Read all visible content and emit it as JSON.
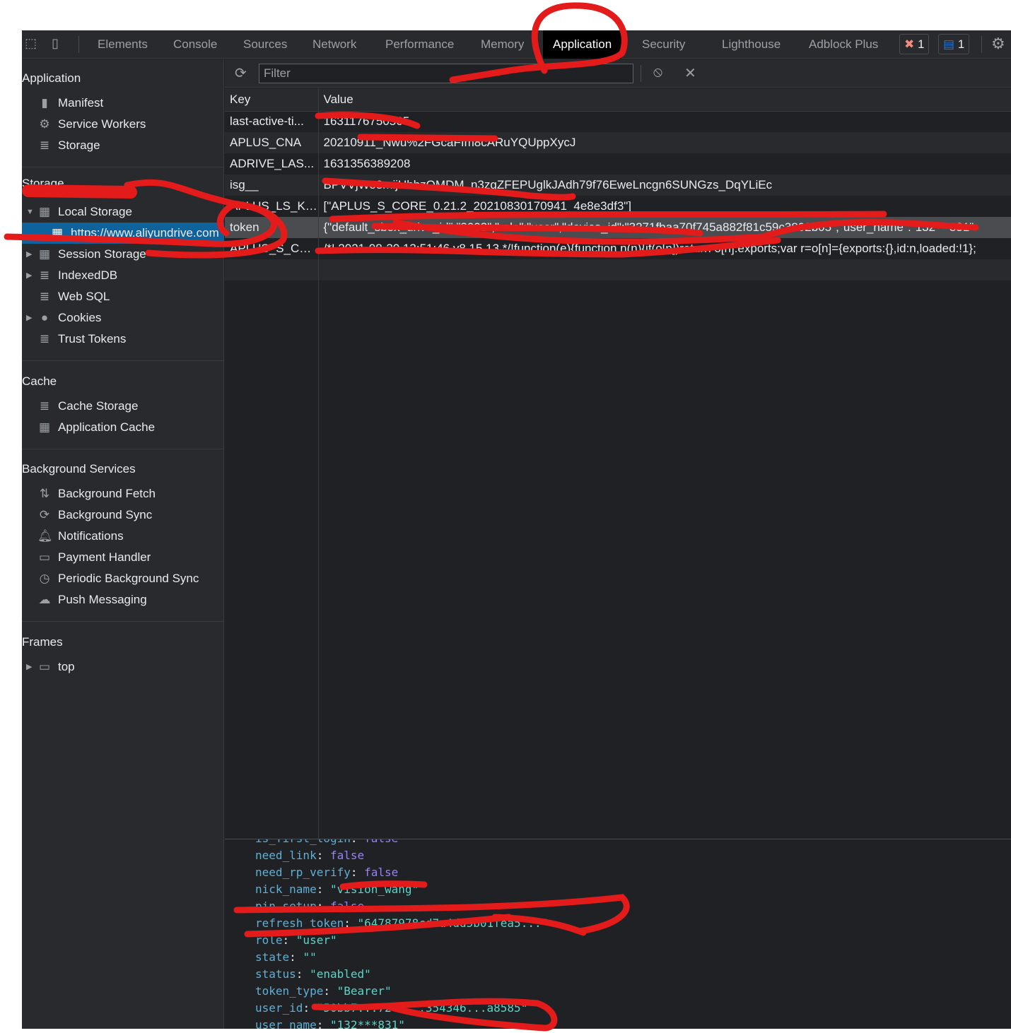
{
  "toolbar": {
    "tabs": [
      "Elements",
      "Console",
      "Sources",
      "Network",
      "Performance",
      "Memory",
      "Application",
      "Security",
      "Lighthouse",
      "Adblock Plus"
    ],
    "active_tab": "Application",
    "errors": "1",
    "messages": "1"
  },
  "sidebar": {
    "application": {
      "title": "Application",
      "items": [
        "Manifest",
        "Service Workers",
        "Storage"
      ]
    },
    "storage": {
      "title": "Storage",
      "items": [
        "Local Storage",
        "https://www.aliyundrive.com",
        "Session Storage",
        "IndexedDB",
        "Web SQL",
        "Cookies",
        "Trust Tokens"
      ]
    },
    "cache": {
      "title": "Cache",
      "items": [
        "Cache Storage",
        "Application Cache"
      ]
    },
    "background": {
      "title": "Background Services",
      "items": [
        "Background Fetch",
        "Background Sync",
        "Notifications",
        "Payment Handler",
        "Periodic Background Sync",
        "Push Messaging"
      ]
    },
    "frames": {
      "title": "Frames",
      "items": [
        "top"
      ]
    }
  },
  "filter": {
    "placeholder": "Filter"
  },
  "table": {
    "headers": [
      "Key",
      "Value"
    ],
    "rows": [
      {
        "key": "last-active-ti...",
        "value": "1631176750565"
      },
      {
        "key": "APLUS_CNA",
        "value": "20210911_Nwu%2FGcaFIm8cARuYQUppXycJ"
      },
      {
        "key": "ADRIVE_LAS...",
        "value": "1631356389208"
      },
      {
        "key": "isg__",
        "value": "BPVVjWo8mijUhbzOMDM_n3zgZFEPUglkJAdh79f76EweLncgn6SUNGzs_DqYLiEc"
      },
      {
        "key": "APLUS_LS_KEY",
        "value": "[\"APLUS_S_CORE_0.21.2_20210830170941_4e8e3df3\"]"
      },
      {
        "key": "token",
        "value": "{\"default_sbox_drive_id\":\"3003\",\"role\":\"user\",\"device_id\":\"3271fbaa70f745a882f81c59c3802b05\",\"user_name\":\"132***831\""
      },
      {
        "key": "APLUS_S_CO...",
        "value": "/*! 2021-08-30 13:51:46 v8.15.13 */!function(e){function n(n){if(o[n])return o[n].exports;var r=o[n]={exports:{},id:n,loaded:!1};"
      }
    ],
    "selected_key": "token"
  },
  "preview": [
    {
      "k": "is_first_login",
      "v": "false",
      "t": "b"
    },
    {
      "k": "need_link",
      "v": "false",
      "t": "b"
    },
    {
      "k": "need_rp_verify",
      "v": "false",
      "t": "b"
    },
    {
      "k": "nick_name",
      "v": "\"vision_wang\"",
      "t": "s"
    },
    {
      "k": "pin_setup",
      "v": "false",
      "t": "b"
    },
    {
      "k": "refresh_token",
      "v": "\"64787978cd7a4dd5b01fea5...\"",
      "t": "s"
    },
    {
      "k": "role",
      "v": "\"user\"",
      "t": "s"
    },
    {
      "k": "state",
      "v": "\"\"",
      "t": "s"
    },
    {
      "k": "status",
      "v": "\"enabled\"",
      "t": "s"
    },
    {
      "k": "token_type",
      "v": "\"Bearer\"",
      "t": "s"
    },
    {
      "k": "user_id",
      "v": "\"50bb7...7245...354346...a8585\"",
      "t": "s"
    },
    {
      "k": "user_name",
      "v": "\"132***831\"",
      "t": "s"
    }
  ],
  "colors": {
    "annotation": "#e31b1b",
    "selection": "#0e639c",
    "active_tab": "#000000"
  }
}
